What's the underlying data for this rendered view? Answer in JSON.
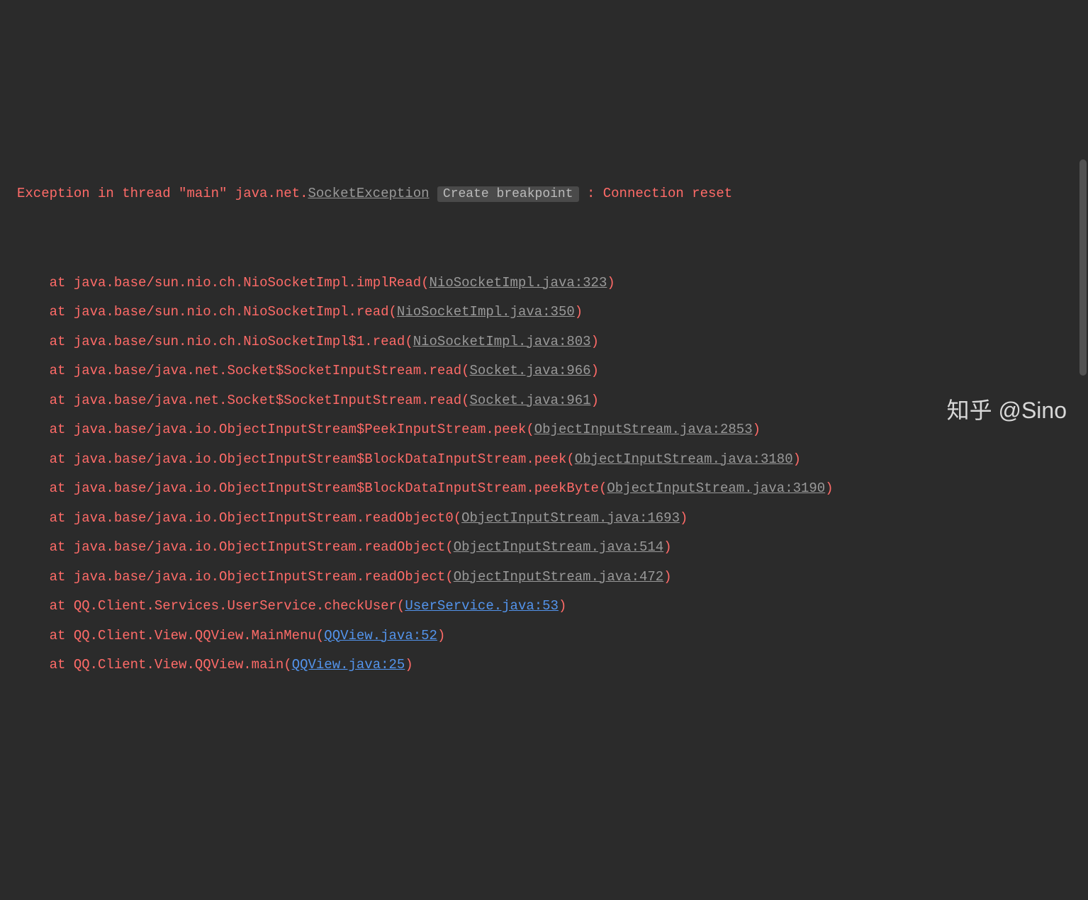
{
  "exception": {
    "prefix": "Exception in thread \"main\" java.net.",
    "exceptionClass": "SocketException",
    "breakpointLabel": "Create breakpoint",
    "message": ": Connection reset"
  },
  "stackFrames": [
    {
      "at": "    at ",
      "location": "java.base/sun.nio.ch.NioSocketImpl.implRead",
      "open": "(",
      "link": "NioSocketImpl.java:323",
      "linkType": "grey",
      "close": ")"
    },
    {
      "at": "    at ",
      "location": "java.base/sun.nio.ch.NioSocketImpl.read",
      "open": "(",
      "link": "NioSocketImpl.java:350",
      "linkType": "grey",
      "close": ")"
    },
    {
      "at": "    at ",
      "location": "java.base/sun.nio.ch.NioSocketImpl$1.read",
      "open": "(",
      "link": "NioSocketImpl.java:803",
      "linkType": "grey",
      "close": ")"
    },
    {
      "at": "    at ",
      "location": "java.base/java.net.Socket$SocketInputStream.read",
      "open": "(",
      "link": "Socket.java:966",
      "linkType": "grey",
      "close": ")"
    },
    {
      "at": "    at ",
      "location": "java.base/java.net.Socket$SocketInputStream.read",
      "open": "(",
      "link": "Socket.java:961",
      "linkType": "grey",
      "close": ")"
    },
    {
      "at": "    at ",
      "location": "java.base/java.io.ObjectInputStream$PeekInputStream.peek",
      "open": "(",
      "link": "ObjectInputStream.java:2853",
      "linkType": "grey",
      "close": ")"
    },
    {
      "at": "    at ",
      "location": "java.base/java.io.ObjectInputStream$BlockDataInputStream.peek",
      "open": "(",
      "link": "ObjectInputStream.java:3180",
      "linkType": "grey",
      "close": ")"
    },
    {
      "at": "    at ",
      "location": "java.base/java.io.ObjectInputStream$BlockDataInputStream.peekByte",
      "open": "(",
      "link": "ObjectInputStream.java:3190",
      "linkType": "grey",
      "close": ")"
    },
    {
      "at": "    at ",
      "location": "java.base/java.io.ObjectInputStream.readObject0",
      "open": "(",
      "link": "ObjectInputStream.java:1693",
      "linkType": "grey",
      "close": ")"
    },
    {
      "at": "    at ",
      "location": "java.base/java.io.ObjectInputStream.readObject",
      "open": "(",
      "link": "ObjectInputStream.java:514",
      "linkType": "grey",
      "close": ")"
    },
    {
      "at": "    at ",
      "location": "java.base/java.io.ObjectInputStream.readObject",
      "open": "(",
      "link": "ObjectInputStream.java:472",
      "linkType": "grey",
      "close": ")"
    },
    {
      "at": "    at ",
      "location": "QQ.Client.Services.UserService.checkUser",
      "open": "(",
      "link": "UserService.java:53",
      "linkType": "blue",
      "close": ")"
    },
    {
      "at": "    at ",
      "location": "QQ.Client.View.QQView.MainMenu",
      "open": "(",
      "link": "QQView.java:52",
      "linkType": "blue",
      "close": ")"
    },
    {
      "at": "    at ",
      "location": "QQ.Client.View.QQView.main",
      "open": "(",
      "link": "QQView.java:25",
      "linkType": "blue",
      "close": ")"
    }
  ],
  "watermark": "知乎 @Sino"
}
